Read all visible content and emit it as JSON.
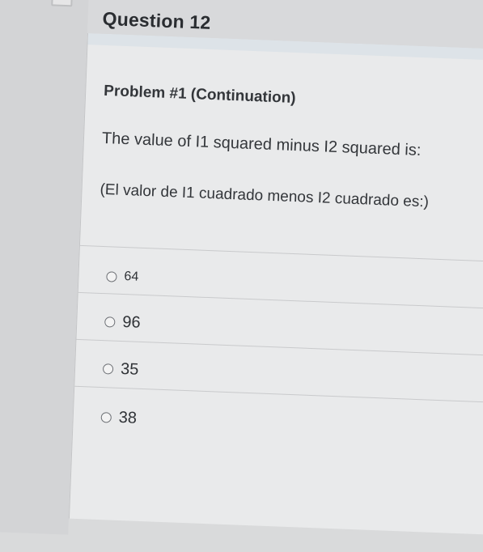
{
  "question": {
    "title": "Question 12",
    "problem": "Problem #1 (Continuation)",
    "prompt_en": "The value of I1 squared minus I2 squared is:",
    "prompt_es": "(El valor de I1 cuadrado menos I2 cuadrado es:)"
  },
  "options": [
    {
      "label": "64"
    },
    {
      "label": "96"
    },
    {
      "label": "35"
    },
    {
      "label": "38"
    }
  ]
}
